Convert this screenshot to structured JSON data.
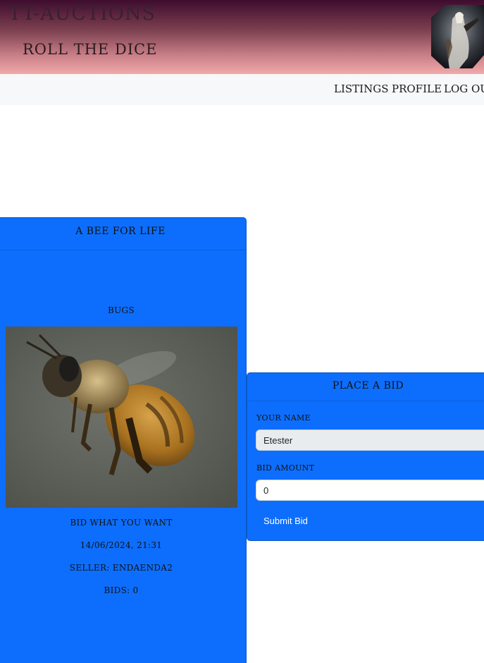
{
  "header": {
    "site_title": "TT-Auctions",
    "tagline": "Roll the Dice",
    "avatar_alt": "profile-picture"
  },
  "nav": {
    "items": [
      {
        "label": "Listings"
      },
      {
        "label": "Profile"
      },
      {
        "label": "Log Out"
      }
    ]
  },
  "listing": {
    "title": "A Bee For Life",
    "category": "Bugs",
    "image": "bee-photo",
    "description": "Bid what you want",
    "date": "14/06/2024, 21:31",
    "seller": "Seller: EndaEnda2",
    "bids": "Bids: 0"
  },
  "bid_form": {
    "title": "Place a Bid",
    "name_label": "Your Name",
    "name_value": "Etester",
    "amount_label": "Bid Amount",
    "amount_value": "0",
    "submit_label": "Submit Bid"
  },
  "colors": {
    "card_blue": "#0d6efd",
    "header_top": "#3e0c2f",
    "header_bottom": "#f2a9a9"
  }
}
